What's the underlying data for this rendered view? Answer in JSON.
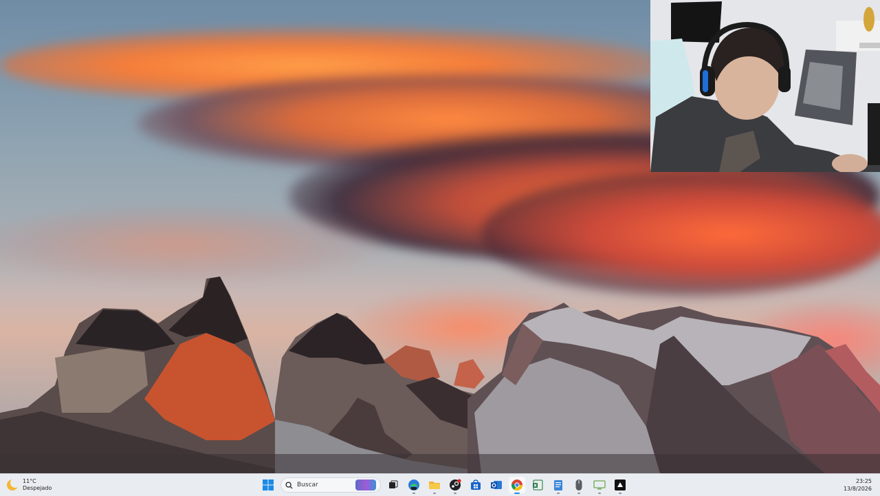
{
  "taskbar": {
    "weather": {
      "icon": "moon-icon",
      "temperature": "11°C",
      "condition": "Despejado"
    },
    "search_placeholder": "Buscar",
    "pinned": [
      {
        "name": "start-button",
        "icon": "windows-logo-icon"
      },
      {
        "name": "search-box",
        "icon": "search-icon"
      },
      {
        "name": "task-view-button",
        "icon": "task-view-icon"
      },
      {
        "name": "store-app-button",
        "icon": "store-icon"
      },
      {
        "name": "file-explorer-button",
        "icon": "folder-icon"
      },
      {
        "name": "steam-button",
        "icon": "steam-icon"
      },
      {
        "name": "ms-store-button",
        "icon": "bag-icon"
      },
      {
        "name": "outlook-button",
        "icon": "outlook-icon"
      },
      {
        "name": "chrome-button",
        "icon": "chrome-icon"
      },
      {
        "name": "excel-button",
        "icon": "spreadsheet-icon"
      },
      {
        "name": "notepad-button",
        "icon": "notepad-icon"
      },
      {
        "name": "mouse-app-button",
        "icon": "mouse-icon"
      },
      {
        "name": "monitor-app-button",
        "icon": "monitor-icon"
      },
      {
        "name": "game-app-button",
        "icon": "game-icon"
      }
    ],
    "clock": {
      "time": "23:25",
      "date": "13/8/2026"
    }
  },
  "colors": {
    "taskbar_bg": "#e9ecf1",
    "windows_blue": "#1a8be6",
    "cloud_orange": "#ff7a3a"
  }
}
